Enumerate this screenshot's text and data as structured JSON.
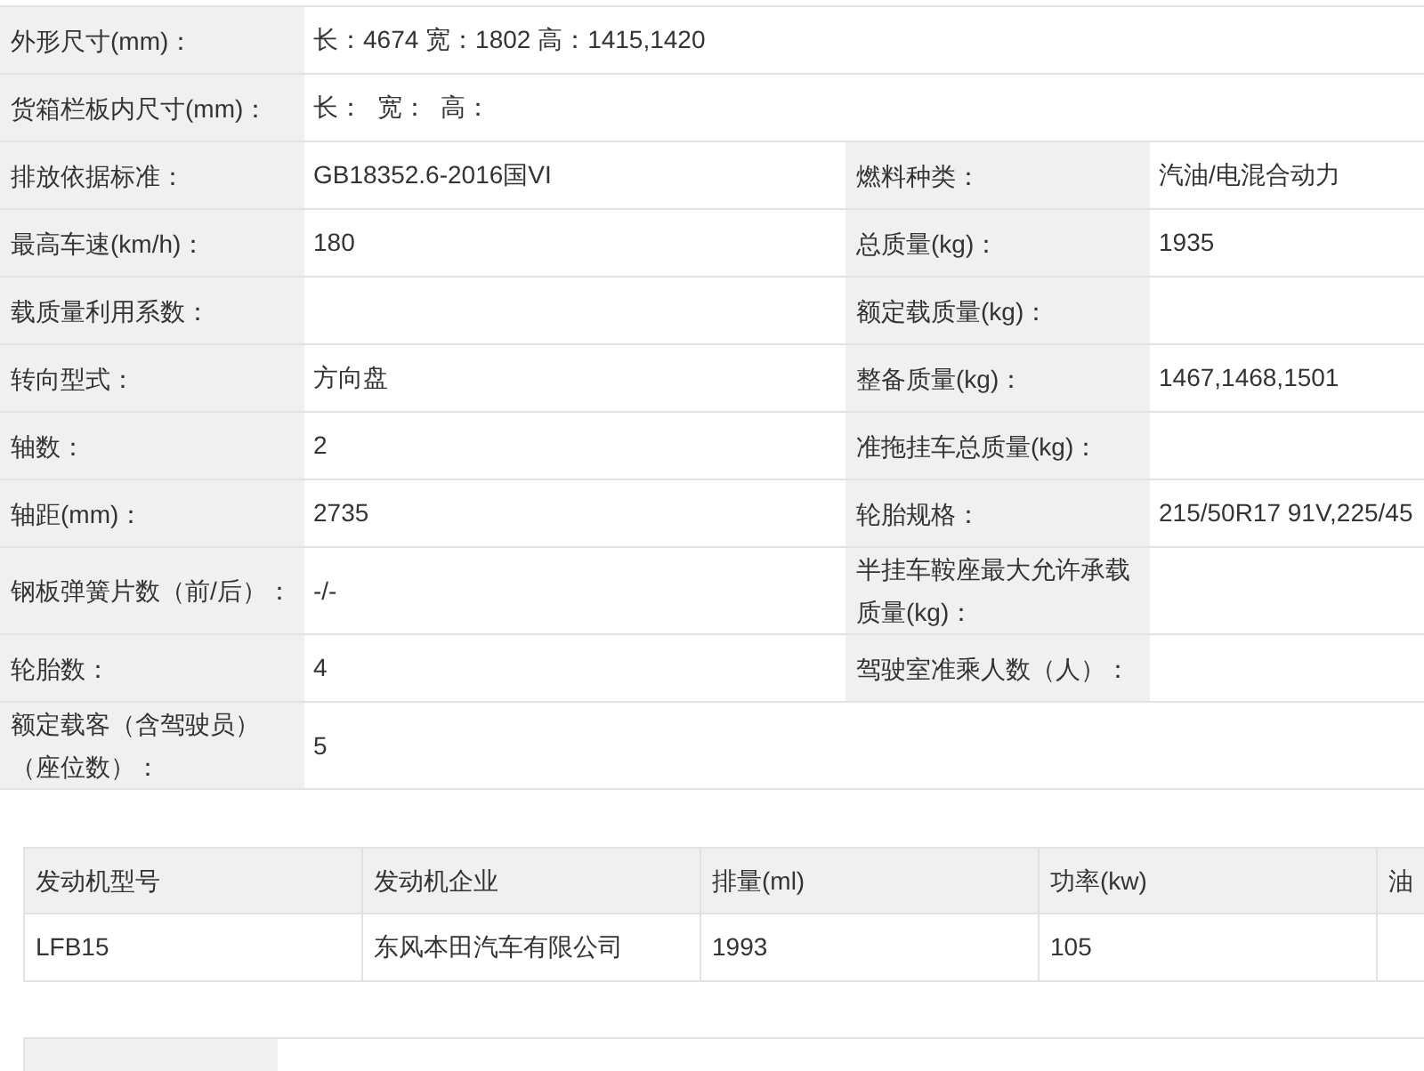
{
  "spec_table": {
    "rows": [
      {
        "pairs": [
          {
            "label": "外形尺寸(mm)：",
            "value": "长：4674 宽：1802 高：1415,1420"
          }
        ]
      },
      {
        "pairs": [
          {
            "label": "货箱栏板内尺寸(mm)：",
            "value": "长：  宽：  高："
          }
        ]
      },
      {
        "pairs": [
          {
            "label": "排放依据标准：",
            "value": "GB18352.6-2016国VI"
          },
          {
            "label": "燃料种类：",
            "value": "汽油/电混合动力"
          }
        ]
      },
      {
        "pairs": [
          {
            "label": "最高车速(km/h)：",
            "value": "180"
          },
          {
            "label": "总质量(kg)：",
            "value": "1935"
          }
        ]
      },
      {
        "pairs": [
          {
            "label": "载质量利用系数："
          },
          {
            "label": "额定载质量(kg)："
          }
        ]
      },
      {
        "pairs": [
          {
            "label": "转向型式：",
            "value": "方向盘"
          },
          {
            "label": "整备质量(kg)：",
            "value": "1467,1468,1501"
          }
        ]
      },
      {
        "pairs": [
          {
            "label": "轴数：",
            "value": "2"
          },
          {
            "label": "准拖挂车总质量(kg)："
          }
        ]
      },
      {
        "pairs": [
          {
            "label": "轴距(mm)：",
            "value": "2735"
          },
          {
            "label": "轮胎规格：",
            "value": "215/50R17 91V,225/45"
          }
        ]
      },
      {
        "pairs": [
          {
            "label": "钢板弹簧片数（前/后）：",
            "value": "-/-"
          },
          {
            "label": "半挂车鞍座最大允许承载质量(kg)："
          }
        ]
      },
      {
        "pairs": [
          {
            "label": "轮胎数：",
            "value": "4"
          },
          {
            "label": "驾驶室准乘人数（人）："
          }
        ]
      },
      {
        "pairs": [
          {
            "label": "额定载客（含驾驶员）（座位数）：",
            "value": "5"
          }
        ]
      }
    ]
  },
  "engine_table": {
    "columns": [
      "发动机型号",
      "发动机企业",
      "排量(ml)",
      "功率(kw)",
      "油"
    ],
    "rows": [
      [
        "LFB15",
        "东风本田汽车有限公司",
        "1993",
        "105"
      ]
    ]
  }
}
